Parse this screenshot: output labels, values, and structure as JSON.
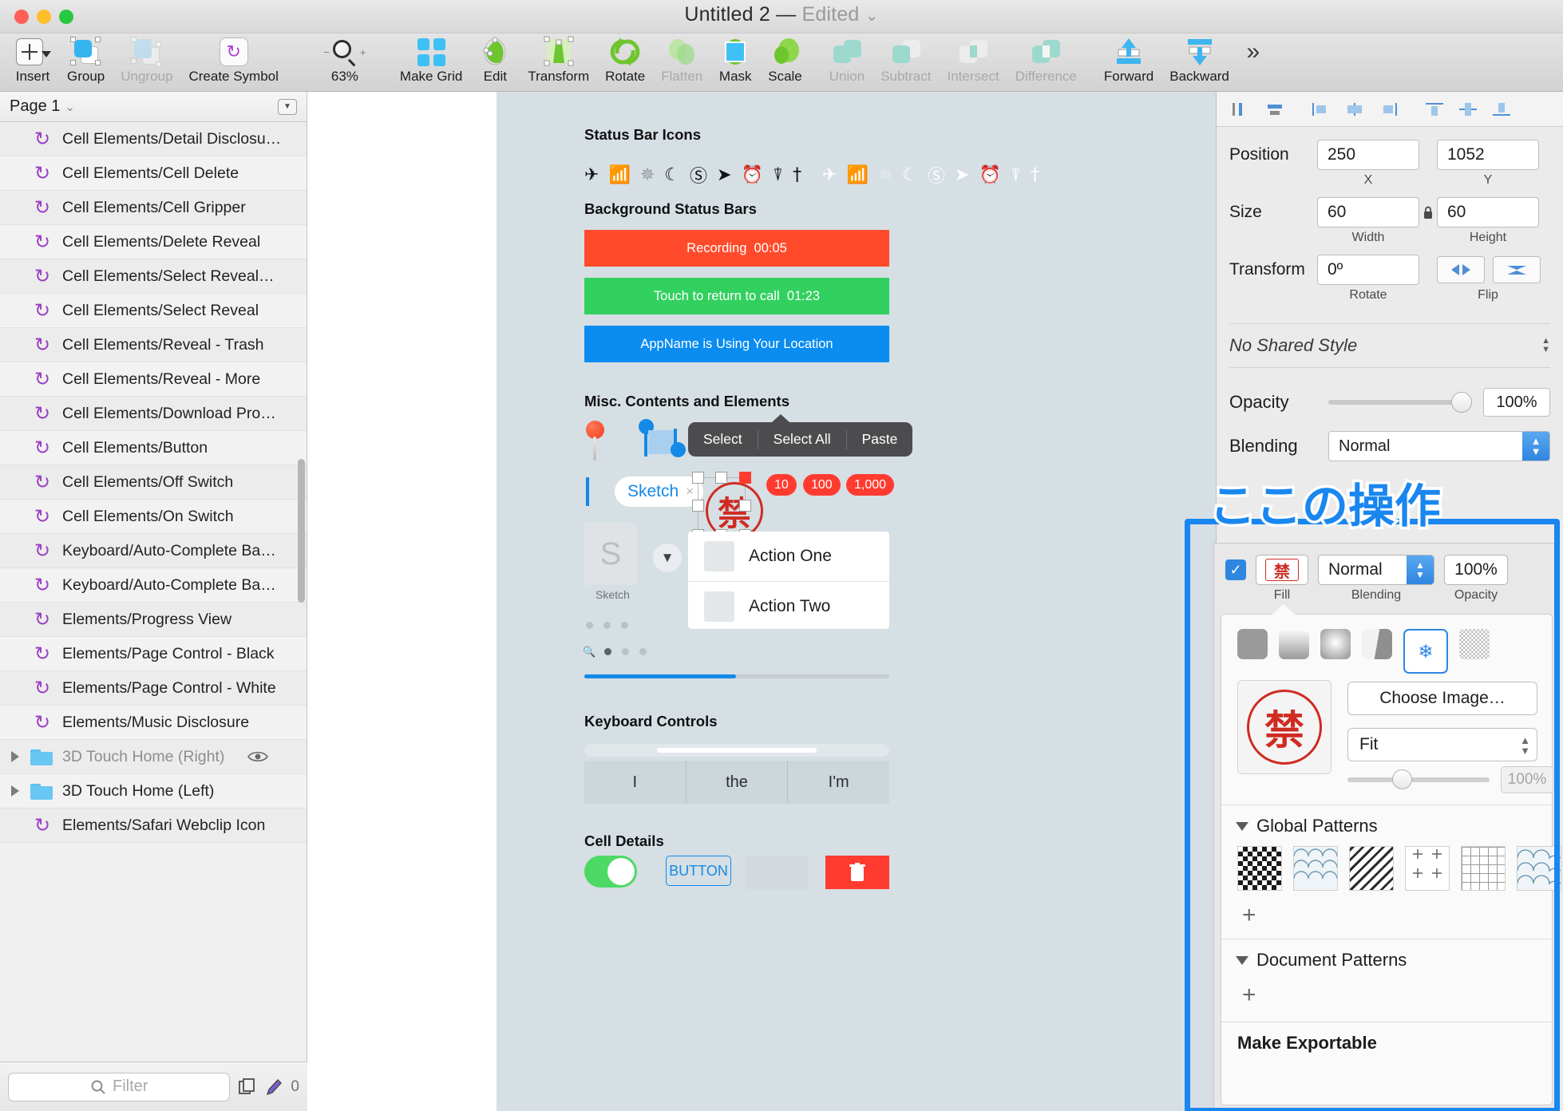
{
  "window": {
    "title": "Untitled 2",
    "separator": "—",
    "state": "Edited",
    "chevron": "⌄"
  },
  "toolbar": {
    "items": [
      {
        "label": "Insert",
        "icon": "plus-box-icon",
        "dim": false
      },
      {
        "label": "Group",
        "icon": "group-icon",
        "dim": false
      },
      {
        "label": "Ungroup",
        "icon": "ungroup-icon",
        "dim": true
      },
      {
        "label": "Create Symbol",
        "icon": "create-symbol-icon",
        "dim": false
      },
      {
        "label": "Make Grid",
        "icon": "make-grid-icon",
        "dim": false
      },
      {
        "label": "Edit",
        "icon": "edit-icon",
        "dim": false
      },
      {
        "label": "Transform",
        "icon": "transform-icon",
        "dim": false
      },
      {
        "label": "Rotate",
        "icon": "rotate-icon",
        "dim": false
      },
      {
        "label": "Flatten",
        "icon": "flatten-icon",
        "dim": true
      },
      {
        "label": "Mask",
        "icon": "mask-icon",
        "dim": false
      },
      {
        "label": "Scale",
        "icon": "scale-icon",
        "dim": false
      },
      {
        "label": "Union",
        "icon": "union-icon",
        "dim": true
      },
      {
        "label": "Subtract",
        "icon": "subtract-icon",
        "dim": true
      },
      {
        "label": "Intersect",
        "icon": "intersect-icon",
        "dim": true
      },
      {
        "label": "Difference",
        "icon": "difference-icon",
        "dim": true
      },
      {
        "label": "Forward",
        "icon": "forward-icon",
        "dim": false
      },
      {
        "label": "Backward",
        "icon": "backward-icon",
        "dim": false
      }
    ],
    "zoom_level": "63%",
    "zoom_out": "−",
    "zoom_in": "+",
    "overflow": "»"
  },
  "sidebar": {
    "page": "Page 1",
    "page_chevron": "⌄",
    "layers": [
      {
        "name": "Cell Elements/Detail Disclosu…",
        "kind": "symbol"
      },
      {
        "name": "Cell Elements/Cell Delete",
        "kind": "symbol"
      },
      {
        "name": "Cell Elements/Cell Gripper",
        "kind": "symbol"
      },
      {
        "name": "Cell Elements/Delete Reveal",
        "kind": "symbol"
      },
      {
        "name": "Cell Elements/Select Reveal…",
        "kind": "symbol"
      },
      {
        "name": "Cell Elements/Select Reveal",
        "kind": "symbol"
      },
      {
        "name": "Cell Elements/Reveal - Trash",
        "kind": "symbol"
      },
      {
        "name": "Cell Elements/Reveal - More",
        "kind": "symbol"
      },
      {
        "name": "Cell Elements/Download Pro…",
        "kind": "symbol"
      },
      {
        "name": "Cell Elements/Button",
        "kind": "symbol"
      },
      {
        "name": "Cell Elements/Off Switch",
        "kind": "symbol"
      },
      {
        "name": "Cell Elements/On Switch",
        "kind": "symbol"
      },
      {
        "name": "Keyboard/Auto-Complete Ba…",
        "kind": "symbol"
      },
      {
        "name": "Keyboard/Auto-Complete Ba…",
        "kind": "symbol"
      },
      {
        "name": "Elements/Progress View",
        "kind": "symbol"
      },
      {
        "name": "Elements/Page Control - Black",
        "kind": "symbol"
      },
      {
        "name": "Elements/Page Control - White",
        "kind": "symbol"
      },
      {
        "name": "Elements/Music Disclosure",
        "kind": "symbol"
      },
      {
        "name": "3D Touch Home (Right)",
        "kind": "folder",
        "dim": true,
        "eye": true
      },
      {
        "name": "3D Touch Home (Left)",
        "kind": "folder"
      },
      {
        "name": "Elements/Safari Webclip Icon",
        "kind": "symbol"
      }
    ],
    "filter_placeholder": "Filter",
    "filter_value": "",
    "badge_count": "0"
  },
  "canvas": {
    "sections": {
      "status_bar_icons": "Status Bar Icons",
      "background_status_bars": "Background Status Bars",
      "misc": "Misc. Contents and Elements",
      "keyboard_controls": "Keyboard Controls",
      "cell_details": "Cell Details"
    },
    "status_icons": [
      "✈",
      "wifi",
      "spinner",
      "☾",
      "lock-rotate",
      "➤",
      "⏰",
      "airplay",
      "bluetooth"
    ],
    "status_bars": [
      {
        "text": "Recording",
        "time": "00:05",
        "color": "#ff4b2b"
      },
      {
        "text": "Touch to return to call",
        "time": "01:23",
        "color": "#32d15f"
      },
      {
        "text": "AppName is Using Your Location",
        "time": "",
        "color": "#0a8cf0"
      }
    ],
    "select_menu": [
      "Select",
      "Select All",
      "Paste"
    ],
    "badges": [
      "10",
      "100",
      "1,000"
    ],
    "token": {
      "label": "Sketch",
      "close": "×"
    },
    "stamp_glyph": "禁",
    "sketch_card": {
      "letter": "S",
      "caption": "Sketch"
    },
    "actions": [
      "Action One",
      "Action Two"
    ],
    "keyboard_keys": [
      "I",
      "the",
      "I'm"
    ],
    "cell_button": "BUTTON"
  },
  "inspector": {
    "position_label": "Position",
    "position_x": "250",
    "position_y": "1052",
    "x_caption": "X",
    "y_caption": "Y",
    "size_label": "Size",
    "width": "60",
    "height": "60",
    "width_caption": "Width",
    "height_caption": "Height",
    "lock_icon": "🔒",
    "transform_label": "Transform",
    "rotate_value": "0º",
    "rotate_caption": "Rotate",
    "flip_caption": "Flip",
    "shared_style": "No Shared Style",
    "opacity_label": "Opacity",
    "opacity_value": "100%",
    "blending_label": "Blending",
    "blending_value": "Normal"
  },
  "fill_popover": {
    "checkbox_checked": true,
    "swatch_glyph": "禁",
    "fill_caption": "Fill",
    "blending_caption": "Blending",
    "blending_value": "Normal",
    "opacity_caption": "Opacity",
    "opacity_value": "100%",
    "fill_types": [
      "solid-fill",
      "linear-gradient",
      "radial-gradient",
      "angular-gradient",
      "pattern-fill",
      "noise-fill"
    ],
    "selected_type": "pattern-fill",
    "preview_glyph": "禁",
    "choose_image": "Choose Image…",
    "fit_value": "Fit",
    "fit_scale": "100%",
    "global_patterns_label": "Global Patterns",
    "document_patterns_label": "Document Patterns",
    "add_glyph": "+",
    "make_exportable": "Make Exportable",
    "global_patterns": [
      "checker-pattern",
      "wave-pattern",
      "diagonal-pattern",
      "cross-pattern",
      "grid-pattern",
      "seigaiha-pattern"
    ]
  },
  "annotation": {
    "text": "ここの操作",
    "color": "#1a86f0"
  }
}
